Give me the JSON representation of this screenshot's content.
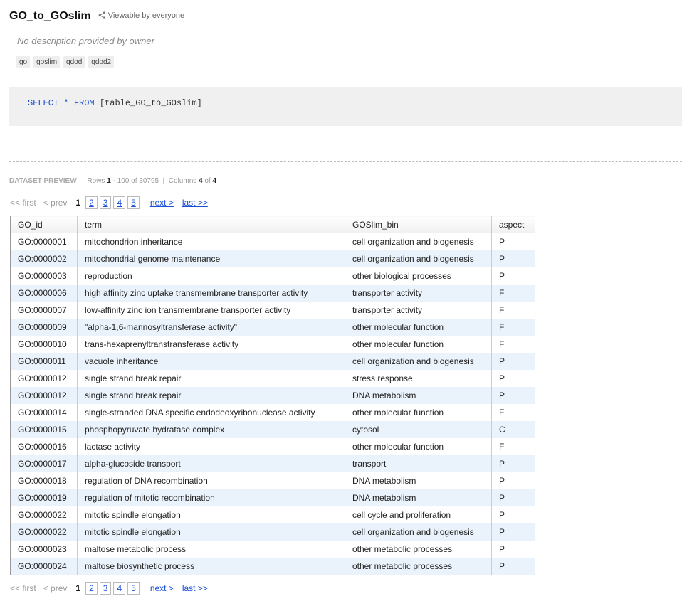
{
  "header": {
    "title": "GO_to_GOslim",
    "viewable": "Viewable by everyone",
    "description": "No description provided by owner",
    "tags": [
      "go",
      "goslim",
      "qdod",
      "qdod2"
    ]
  },
  "query": {
    "kw_select": "SELECT",
    "star": "*",
    "kw_from": "FROM",
    "table": "[table_GO_to_GOslim]"
  },
  "preview": {
    "label": "DATASET PREVIEW",
    "rows_label": "Rows",
    "row_start": "1",
    "row_end": "100",
    "of": "of",
    "total_rows": "30795",
    "columns_label": "Columns",
    "cols_shown": "4",
    "cols_total": "4"
  },
  "pager": {
    "first": "<< first",
    "prev": "< prev",
    "current": "1",
    "pages": [
      "2",
      "3",
      "4",
      "5"
    ],
    "next": "next >",
    "last": "last >>"
  },
  "table": {
    "columns": [
      "GO_id",
      "term",
      "GOSlim_bin",
      "aspect"
    ],
    "rows": [
      [
        "GO:0000001",
        "mitochondrion inheritance",
        "cell organization and biogenesis",
        "P"
      ],
      [
        "GO:0000002",
        "mitochondrial genome maintenance",
        "cell organization and biogenesis",
        "P"
      ],
      [
        "GO:0000003",
        "reproduction",
        "other biological processes",
        "P"
      ],
      [
        "GO:0000006",
        "high affinity zinc uptake transmembrane transporter activity",
        "transporter activity",
        "F"
      ],
      [
        "GO:0000007",
        "low-affinity zinc ion transmembrane transporter activity",
        "transporter activity",
        "F"
      ],
      [
        "GO:0000009",
        "\"alpha-1,6-mannosyltransferase activity\"",
        "other molecular function",
        "F"
      ],
      [
        "GO:0000010",
        "trans-hexaprenyltranstransferase activity",
        "other molecular function",
        "F"
      ],
      [
        "GO:0000011",
        "vacuole inheritance",
        "cell organization and biogenesis",
        "P"
      ],
      [
        "GO:0000012",
        "single strand break repair",
        "stress response",
        "P"
      ],
      [
        "GO:0000012",
        "single strand break repair",
        "DNA metabolism",
        "P"
      ],
      [
        "GO:0000014",
        "single-stranded DNA specific endodeoxyribonuclease activity",
        "other molecular function",
        "F"
      ],
      [
        "GO:0000015",
        "phosphopyruvate hydratase complex",
        "cytosol",
        "C"
      ],
      [
        "GO:0000016",
        "lactase activity",
        "other molecular function",
        "F"
      ],
      [
        "GO:0000017",
        "alpha-glucoside transport",
        "transport",
        "P"
      ],
      [
        "GO:0000018",
        "regulation of DNA recombination",
        "DNA metabolism",
        "P"
      ],
      [
        "GO:0000019",
        "regulation of mitotic recombination",
        "DNA metabolism",
        "P"
      ],
      [
        "GO:0000022",
        "mitotic spindle elongation",
        "cell cycle and proliferation",
        "P"
      ],
      [
        "GO:0000022",
        "mitotic spindle elongation",
        "cell organization and biogenesis",
        "P"
      ],
      [
        "GO:0000023",
        "maltose metabolic process",
        "other metabolic processes",
        "P"
      ],
      [
        "GO:0000024",
        "maltose biosynthetic process",
        "other metabolic processes",
        "P"
      ]
    ]
  },
  "colors": {
    "link": "#1a4fd6",
    "row_alt": "#eaf2fb"
  },
  "icons": {
    "share": "share-icon"
  }
}
